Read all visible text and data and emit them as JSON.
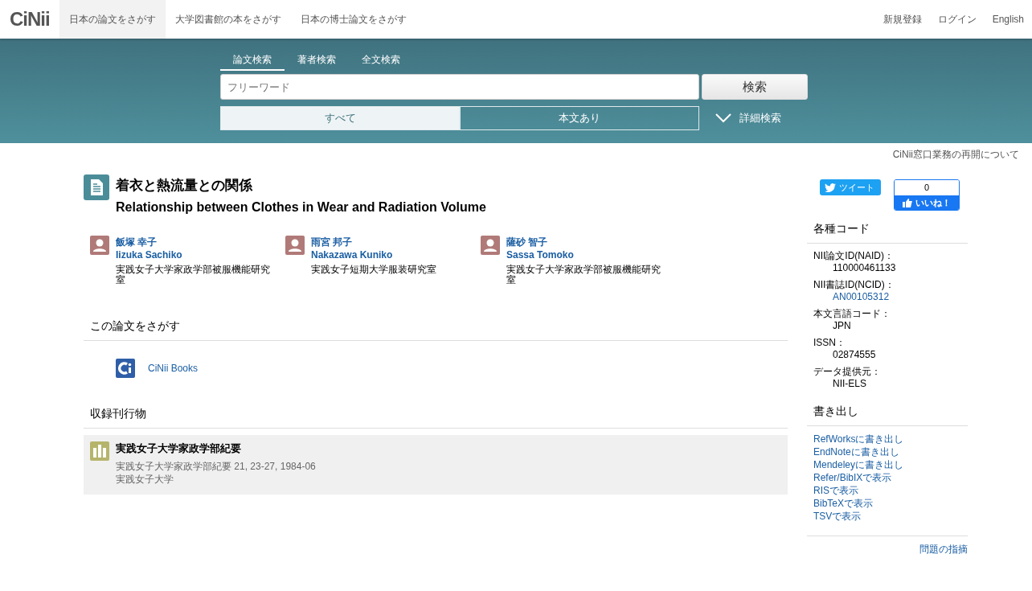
{
  "header": {
    "logo": "CiNii",
    "nav": [
      {
        "label": "日本の論文をさがす",
        "selected": true
      },
      {
        "label": "大学図書館の本をさがす",
        "selected": false
      },
      {
        "label": "日本の博士論文をさがす",
        "selected": false
      }
    ],
    "user_links": [
      "新規登録",
      "ログイン",
      "English"
    ]
  },
  "search": {
    "tabs": [
      {
        "label": "論文検索",
        "selected": true
      },
      {
        "label": "著者検索",
        "selected": false
      },
      {
        "label": "全文検索",
        "selected": false
      }
    ],
    "placeholder": "フリーワード",
    "button": "検索",
    "filters": [
      {
        "label": "すべて",
        "selected": true
      },
      {
        "label": "本文あり",
        "selected": false
      }
    ],
    "advanced": "詳細検索"
  },
  "notice": "CiNii窓口業務の再開について",
  "article": {
    "title": "着衣と熱流量との関係",
    "title_en": "Relationship between Clothes in Wear and Radiation Volume",
    "authors": [
      {
        "name": "飯塚 幸子",
        "name_en": "Iizuka Sachiko",
        "affiliation": "実践女子大学家政学部被服機能研究室"
      },
      {
        "name": "雨宮 邦子",
        "name_en": "Nakazawa Kuniko",
        "affiliation": "実践女子短期大学服装研究室"
      },
      {
        "name": "薩砂 智子",
        "name_en": "Sassa Tomoko",
        "affiliation": "実践女子大学家政学部被服機能研究室"
      }
    ]
  },
  "find": {
    "heading": "この論文をさがす",
    "links": [
      "CiNii Books"
    ]
  },
  "journal": {
    "heading": "収録刊行物",
    "title": "実践女子大学家政学部紀要",
    "citation": "実践女子大学家政学部紀要 21, 23-27, 1984-06",
    "publisher": "実践女子大学"
  },
  "social": {
    "tweet": "ツイート",
    "like_count": "0",
    "like": "いいね！"
  },
  "codes": {
    "heading": "各種コード",
    "items": [
      {
        "label": "NII論文ID(NAID)：",
        "value": "110000461133",
        "kind": "text"
      },
      {
        "label": "NII書誌ID(NCID)：",
        "value": "AN00105312",
        "kind": "link"
      },
      {
        "label": "本文言語コード：",
        "value": "JPN",
        "kind": "text"
      },
      {
        "label": "ISSN：",
        "value": "02874555",
        "kind": "text"
      },
      {
        "label": "データ提供元：",
        "value": "NII-ELS",
        "kind": "text"
      }
    ]
  },
  "export": {
    "heading": "書き出し",
    "links": [
      "RefWorksに書き出し",
      "EndNoteに書き出し",
      "Mendeleyに書き出し",
      "Refer/BibIXで表示",
      "RISで表示",
      "BibTeXで表示",
      "TSVで表示"
    ]
  },
  "report": "問題の指摘"
}
